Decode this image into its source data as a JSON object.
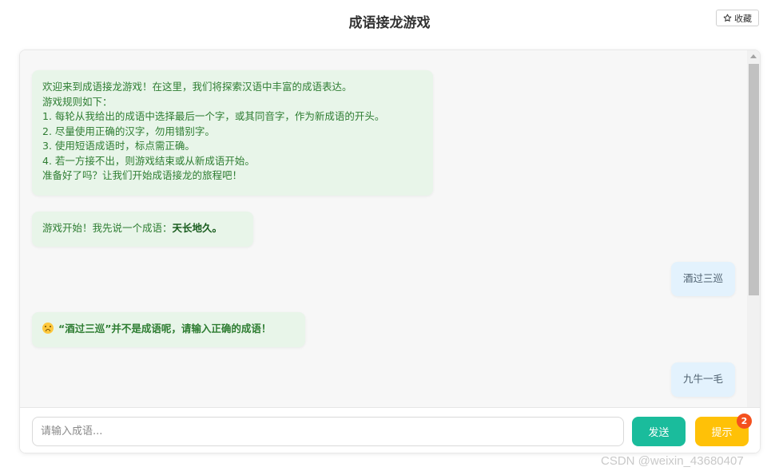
{
  "header": {
    "title": "成语接龙游戏",
    "favorite_label": "收藏"
  },
  "messages": {
    "welcome": {
      "lines": [
        "欢迎来到成语接龙游戏！在这里，我们将探索汉语中丰富的成语表达。",
        "游戏规则如下：",
        "1. 每轮从我给出的成语中选择最后一个字，或其同音字，作为新成语的开头。",
        "2. 尽量使用正确的汉字，勿用错别字。",
        "3. 使用短语成语时，标点需正确。",
        "4. 若一方接不出，则游戏结束或从新成语开始。",
        "准备好了吗？让我们开始成语接龙的旅程吧！"
      ]
    },
    "start": {
      "prefix": "游戏开始！我先说一个成语：",
      "idiom": "天长地久。"
    },
    "user_1": "酒过三巡",
    "error": "“酒过三巡”并不是成语呢，请输入正确的成语！",
    "user_2": "九牛一毛"
  },
  "input": {
    "placeholder": "请输入成语...",
    "value": ""
  },
  "buttons": {
    "send_label": "发送",
    "hint_label": "提示",
    "hint_badge": "2"
  },
  "watermark": "CSDN @weixin_43680407",
  "colors": {
    "bot_bubble": "#e8f5e9",
    "user_bubble": "#e3f2fd",
    "send": "#1abc9c",
    "hint": "#ffc107",
    "badge": "#f4511e",
    "error_text": "#e64a19"
  },
  "icons": {
    "favorite": "star-outline-icon",
    "error": "frowning-face-icon"
  }
}
